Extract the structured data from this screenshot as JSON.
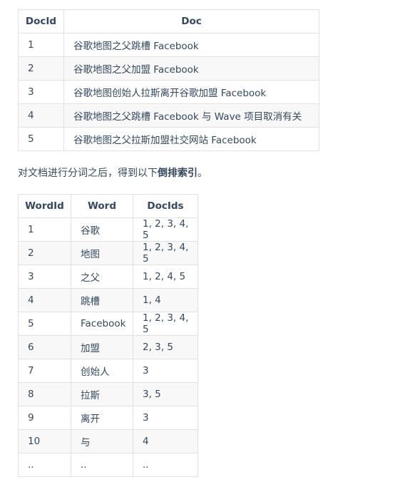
{
  "doc_table": {
    "headers": [
      "DocId",
      "Doc"
    ],
    "rows": [
      [
        "1",
        "谷歌地图之父跳槽 Facebook"
      ],
      [
        "2",
        "谷歌地图之父加盟 Facebook"
      ],
      [
        "3",
        "谷歌地图创始人拉斯离开谷歌加盟 Facebook"
      ],
      [
        "4",
        "谷歌地图之父跳槽 Facebook 与 Wave 项目取消有关"
      ],
      [
        "5",
        "谷歌地图之父拉斯加盟社交网站 Facebook"
      ]
    ]
  },
  "paragraph": {
    "prefix": "对文档进行分词之后，得到以下",
    "emphasis": "倒排索引",
    "suffix": "。"
  },
  "word_table": {
    "headers": [
      "WordId",
      "Word",
      "DocIds"
    ],
    "rows": [
      [
        "1",
        "谷歌",
        "1, 2, 3, 4, 5"
      ],
      [
        "2",
        "地图",
        "1, 2, 3, 4, 5"
      ],
      [
        "3",
        "之父",
        "1, 2, 4, 5"
      ],
      [
        "4",
        "跳槽",
        "1, 4"
      ],
      [
        "5",
        "Facebook",
        "1, 2, 3, 4, 5"
      ],
      [
        "6",
        "加盟",
        "2, 3, 5"
      ],
      [
        "7",
        "创始人",
        "3"
      ],
      [
        "8",
        "拉斯",
        "3, 5"
      ],
      [
        "9",
        "离开",
        "3"
      ],
      [
        "10",
        "与",
        "4"
      ],
      [
        "..",
        "..",
        ".."
      ]
    ]
  }
}
